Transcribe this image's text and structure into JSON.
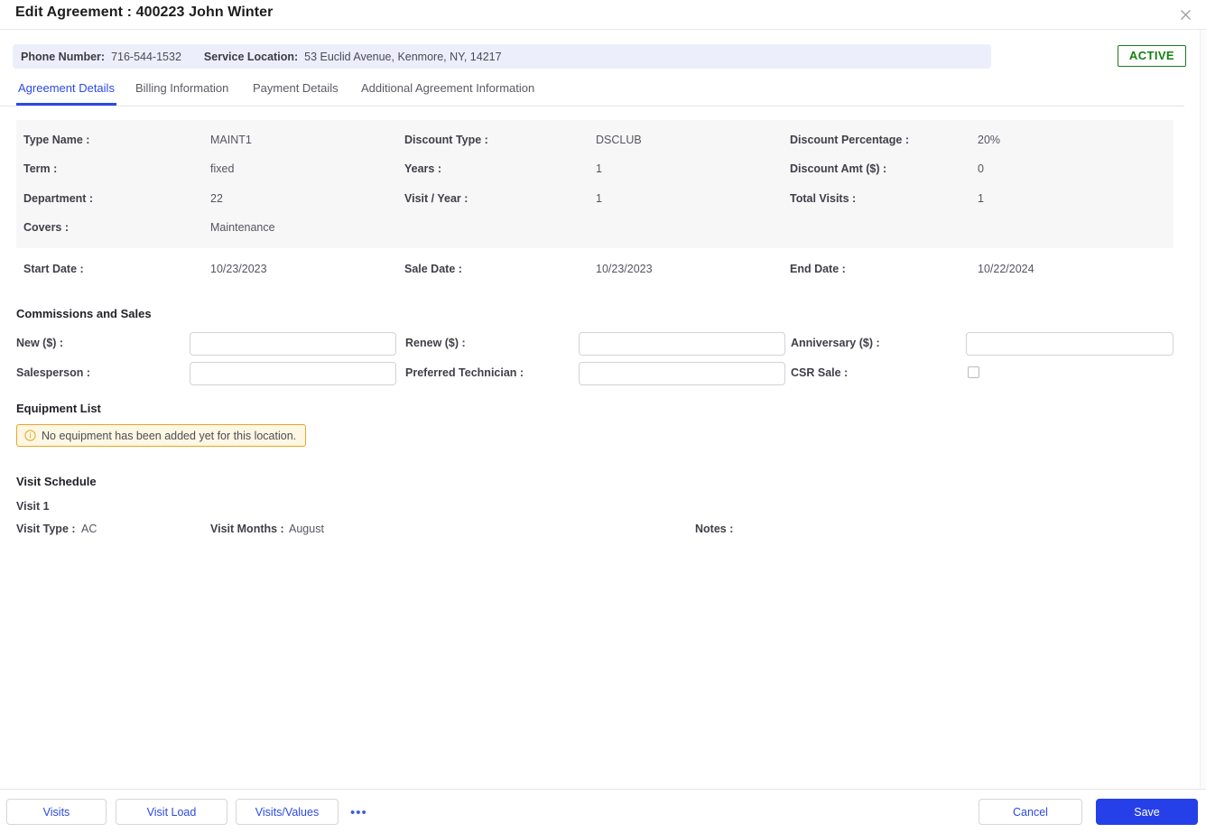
{
  "window": {
    "title": "Edit Agreement : 400223 John Winter",
    "close_icon": "close-icon"
  },
  "info_bar": {
    "phone_label": "Phone Number:",
    "phone_value": "716-544-1532",
    "location_label": "Service Location:",
    "location_value": "53 Euclid Avenue, Kenmore, NY, 14217"
  },
  "status": {
    "label": "ACTIVE",
    "color": "#138013",
    "border_color": "#1d7a21"
  },
  "tabs": [
    {
      "label": "Agreement Details",
      "active": true
    },
    {
      "label": "Billing Information",
      "active": false
    },
    {
      "label": "Payment Details",
      "active": false
    },
    {
      "label": "Additional Agreement Information",
      "active": false
    }
  ],
  "details": {
    "col1": [
      {
        "label": "Type Name :",
        "value": "MAINT1"
      },
      {
        "label": "Term :",
        "value": "fixed"
      },
      {
        "label": "Department :",
        "value": "22"
      },
      {
        "label": "Covers :",
        "value": "Maintenance"
      }
    ],
    "col2": [
      {
        "label": "Discount Type :",
        "value": "DSCLUB"
      },
      {
        "label": "Years :",
        "value": "1"
      },
      {
        "label": "Visit / Year :",
        "value": "1"
      }
    ],
    "col3": [
      {
        "label": "Discount Percentage :",
        "value": "20%"
      },
      {
        "label": "Discount Amt ($) :",
        "value": "0"
      },
      {
        "label": "Total Visits :",
        "value": "1"
      }
    ],
    "dates": [
      {
        "label": "Start Date :",
        "value": "10/23/2023"
      },
      {
        "label": "Sale Date :",
        "value": "10/23/2023"
      },
      {
        "label": "End Date :",
        "value": "10/22/2024"
      }
    ]
  },
  "commissions": {
    "heading": "Commissions and Sales",
    "new_label": "New ($) :",
    "new_value": "",
    "renew_label": "Renew ($) :",
    "renew_value": "",
    "anniversary_label": "Anniversary ($) :",
    "anniversary_value": "",
    "salesperson_label": "Salesperson :",
    "salesperson_value": "",
    "preferred_tech_label": "Preferred Technician :",
    "preferred_tech_value": "",
    "csr_sale_label": "CSR Sale :",
    "csr_sale_checked": false
  },
  "equipment": {
    "heading": "Equipment List",
    "alert_icon": "info-circle-icon",
    "alert_message": "No equipment has been added yet for this location."
  },
  "visit_schedule": {
    "heading": "Visit Schedule",
    "visit_title": "Visit 1",
    "visit_type_label": "Visit Type :",
    "visit_type_value": "AC",
    "visit_months_label": "Visit Months :",
    "visit_months_value": "August",
    "notes_label": "Notes :",
    "notes_value": ""
  },
  "footer": {
    "visits_label": "Visits",
    "visit_load_label": "Visit Load",
    "visits_values_label": "Visits/Values",
    "overflow_label": "•••",
    "cancel_label": "Cancel",
    "save_label": "Save"
  }
}
